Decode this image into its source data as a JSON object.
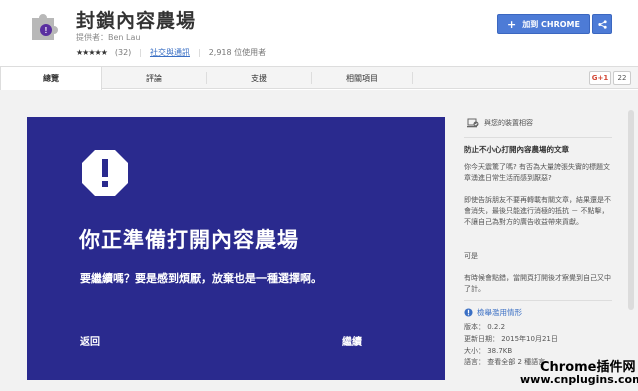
{
  "header": {
    "title": "封鎖內容農場",
    "provider": "提供者：Ben Lau",
    "stars": "★★★★★",
    "rating_count": "(32)",
    "category": "社交與通訊",
    "users": "2,918 位使用者",
    "add_button": "加到 CHROME",
    "add_icon": "plus-icon",
    "share_icon": "share-icon"
  },
  "tabs": [
    {
      "label": "總覽"
    },
    {
      "label": "評論"
    },
    {
      "label": "支援"
    },
    {
      "label": "相關項目"
    }
  ],
  "social": {
    "gplus_label": "G+1",
    "gplus_count": "22"
  },
  "screenshot": {
    "title": "你正準備打開內容農場",
    "subtitle": "要繼續嗎？要是感到煩厭，放棄也是一種選擇啊。",
    "back": "返回",
    "continue": "繼續"
  },
  "sidebar": {
    "compat": "與您的裝置相容",
    "desc_title": "防止不小心打開內容農場的文章",
    "para1": "你今天震驚了嗎? 有否為大量誇張失實的標題文章湧進日常生活而感到厭惡?",
    "para2": "即使告訴朋友不要再轉載有關文章，結果還是不會消失，最後只能進行消極的抵抗 － 不點擊，不讓自己為對方的廣告收益帶來貢獻。",
    "para3": "可是",
    "para4": "有時候會點錯，當開頁打開後才察覺到自己又中了計。",
    "report": "檢舉濫用情形",
    "version": "版本： 0.2.2",
    "updated": "更新日期： 2015年10月21日",
    "size": "大小： 38.7KB",
    "languages": "語言： 查看全部 2 種語言"
  },
  "watermark": {
    "line1": "Chrome插件网",
    "line2": "www.cnplugins.com"
  },
  "colors": {
    "accent": "#4d7bd6",
    "screenshot_bg": "#2a2a8e",
    "link": "#3a6fc4"
  }
}
